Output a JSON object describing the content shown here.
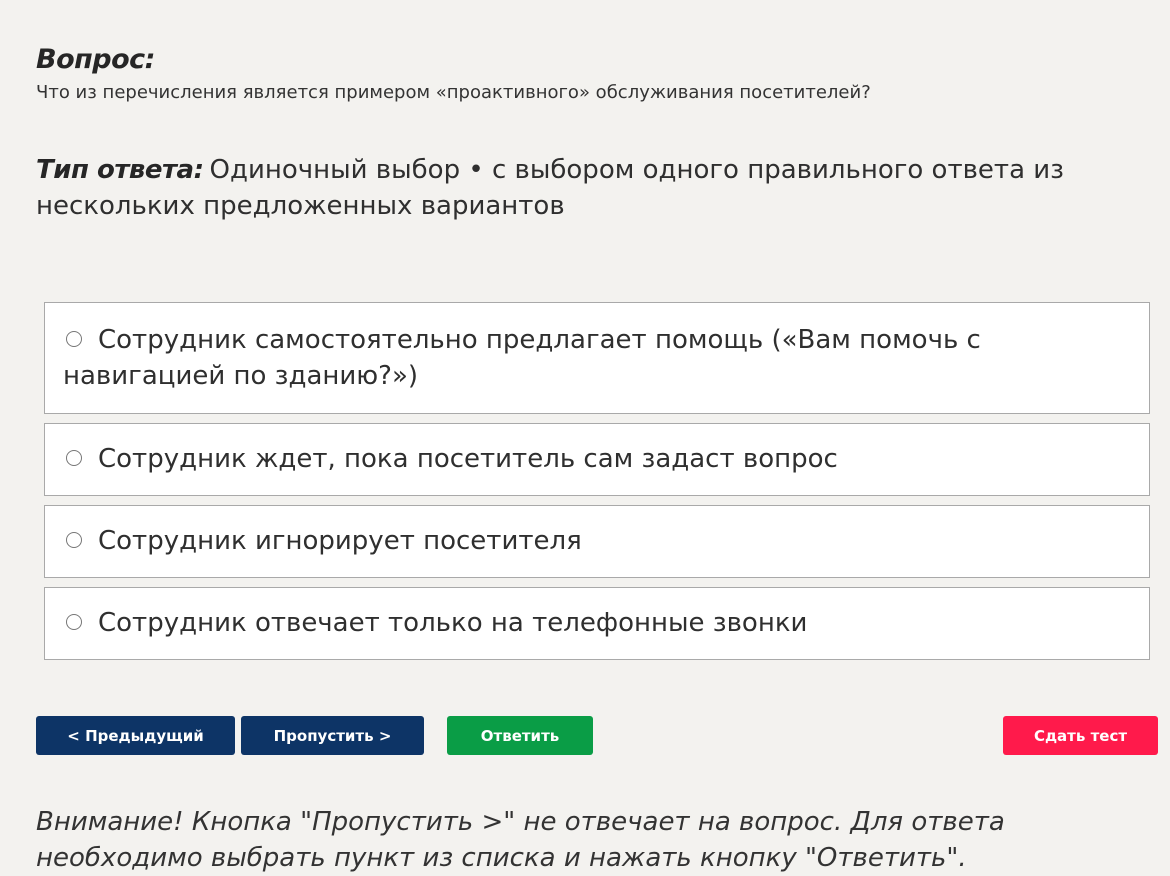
{
  "question": {
    "label": "Вопрос:",
    "text": "Что из перечисления является примером «проактивного» обслуживания посетителей?"
  },
  "answer_type": {
    "label": "Тип ответа:",
    "text": "Одиночный выбор • с выбором одного правильного ответа из нескольких предложенных вариантов"
  },
  "options": [
    {
      "label": "Сотрудник самостоятельно предлагает помощь («Вам помочь с навигацией по зданию?»)",
      "selected": false
    },
    {
      "label": "Сотрудник ждет, пока посетитель сам задаст вопрос",
      "selected": false
    },
    {
      "label": "Сотрудник игнорирует посетителя",
      "selected": false
    },
    {
      "label": "Сотрудник отвечает только на телефонные звонки",
      "selected": false
    }
  ],
  "buttons": {
    "prev": "< Предыдущий",
    "skip": "Пропустить >",
    "answer": "Ответить",
    "submit": "Сдать тест"
  },
  "notice": "Внимание! Кнопка \"Пропустить >\" не отвечает на вопрос. Для ответа необходимо выбрать пункт из списка и нажать кнопку \"Ответить\".",
  "colors": {
    "background": "#f3f2ef",
    "nav_button": "#0d3466",
    "answer_button": "#0a9d46",
    "submit_button": "#ff1a4b"
  },
  "icons": {
    "option_marker": "radio-unchecked-icon"
  }
}
